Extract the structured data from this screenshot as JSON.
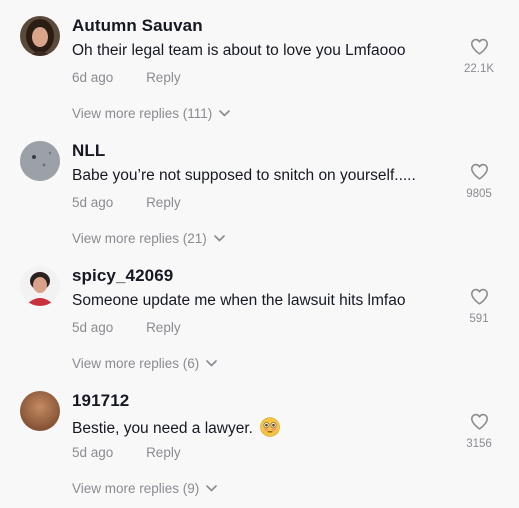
{
  "comments": [
    {
      "username": "Autumn Sauvan",
      "text": "Oh their legal team is about to love you Lmfaooo",
      "emoji": "",
      "time": "6d ago",
      "reply_label": "Reply",
      "likes": "22.1K",
      "view_more": "View more replies (111)",
      "avatar_colors": {
        "bg": "#5a4a3a",
        "face": "#d9a58a",
        "hair": "#2a1d14"
      }
    },
    {
      "username": "NLL",
      "text": "Babe you’re not supposed to snitch on yourself.....",
      "emoji": "",
      "time": "5d ago",
      "reply_label": "Reply",
      "likes": "9805",
      "view_more": "View more replies (21)",
      "avatar_colors": {
        "bg": "#8e949c",
        "face": "#a9adb3",
        "hair": "#6e747b"
      }
    },
    {
      "username": "spicy_42069",
      "text": "Someone update me when the lawsuit hits lmfao",
      "emoji": "",
      "time": "5d ago",
      "reply_label": "Reply",
      "likes": "591",
      "view_more": "View more replies (6)",
      "avatar_colors": {
        "bg": "#f2f2f2",
        "face": "#d9a08a",
        "hair": "#2b2220",
        "shirt": "#c8323c"
      }
    },
    {
      "username": "191712",
      "text": "Bestie, you need a lawyer.",
      "emoji": "flushed-face-emoji",
      "time": "5d ago",
      "reply_label": "Reply",
      "likes": "3156",
      "view_more": "View more replies (9)",
      "avatar_colors": {
        "bg": "#8a5a3a",
        "face": "#b97a55",
        "hair": "#6b4028"
      }
    }
  ],
  "colors": {
    "background": "#f8f8f8",
    "primary_text": "#161823",
    "secondary_text": "#8a8b91"
  },
  "icons": {
    "like": "heart-outline-icon",
    "expand": "chevron-down-icon"
  }
}
